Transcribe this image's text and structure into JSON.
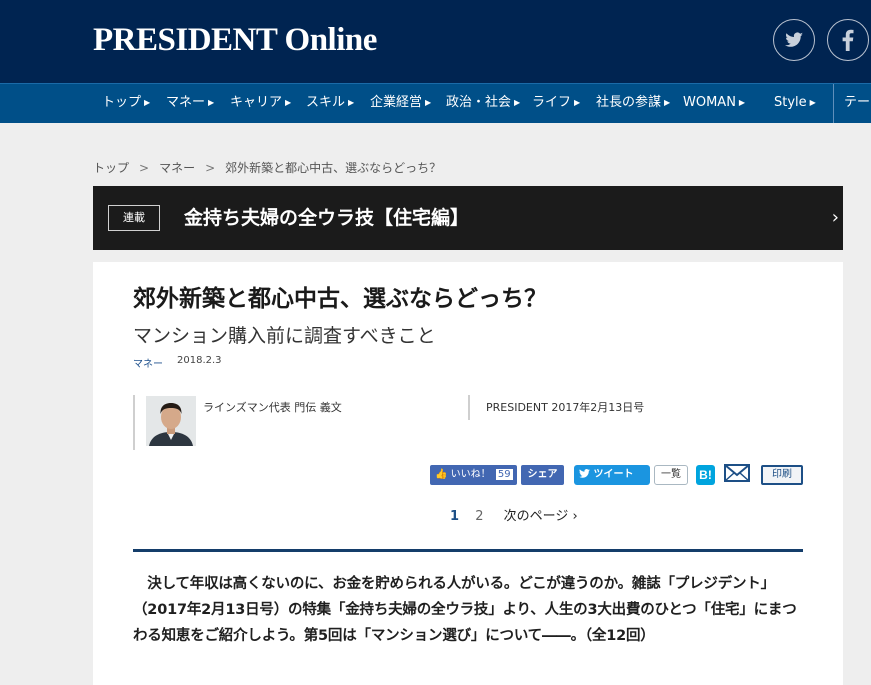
{
  "header": {
    "logo_text": "PRESIDENT Online",
    "social": [
      {
        "icon": "twitter-icon"
      },
      {
        "icon": "facebook-icon"
      }
    ]
  },
  "nav": {
    "items": [
      {
        "label": "トップ"
      },
      {
        "label": "マネー"
      },
      {
        "label": "キャリア"
      },
      {
        "label": "スキル"
      },
      {
        "label": "企業経営"
      },
      {
        "label": "政治・社会"
      },
      {
        "label": "ライフ"
      },
      {
        "label": "社長の参謀"
      },
      {
        "label": "WOMAN"
      },
      {
        "label": "Style"
      },
      {
        "label": "テー"
      }
    ]
  },
  "breadcrumb": {
    "items": [
      "トップ",
      "マネー",
      "郊外新築と都心中古、選ぶならどっち？"
    ],
    "separator": ">"
  },
  "series": {
    "badge": "連載",
    "title": "金持ち夫婦の全ウラ技【住宅編】",
    "chevron": "›"
  },
  "article": {
    "title": "郊外新築と都心中古、選ぶならどっち？",
    "subtitle": "マンション購入前に調査すべきこと",
    "category": "マネー",
    "date": "2018.2.3",
    "author": "ラインズマン代表 門伝 義文",
    "source": "PRESIDENT 2017年2月13日号",
    "lead": "　決して年収は高くないのに、お金を貯められる人がいる。どこが違うのか。雑誌「プレジデント」（2017年2月13日号）の特集「金持ち夫婦の全ウラ技」より、人生の3大出費のひとつ「住宅」にまつわる知恵をご紹介しよう。第5回は「マンション選び」について――。（全12回）"
  },
  "share": {
    "like_label": "いいね！",
    "like_count": "59",
    "share_label": "シェア",
    "tweet_label": "ツイート",
    "tweet_list_label": "一覧",
    "hatena_label": "B!",
    "print_label": "印刷"
  },
  "pagination": {
    "current": "1",
    "next_number": "2",
    "next_label": "次のページ"
  },
  "colors": {
    "header_bg": "#002451",
    "nav_bg": "#004f88",
    "accent": "#1d4f86",
    "facebook": "#4267b2",
    "twitter": "#1b95e0",
    "hatena": "#00a4de"
  }
}
